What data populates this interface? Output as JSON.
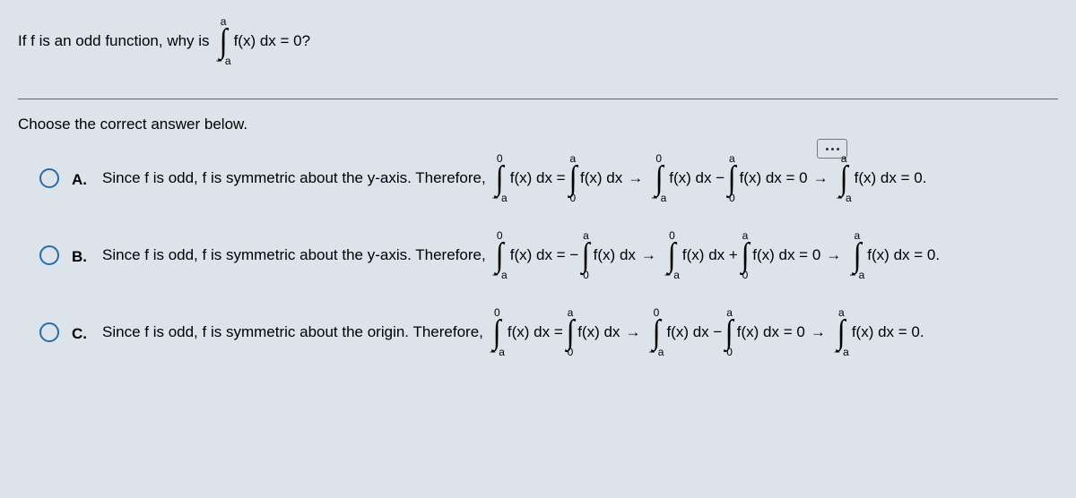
{
  "question": {
    "lead": "If f is an odd function, why is",
    "int_upper": "a",
    "int_lower": "− a",
    "integrand": "f(x) dx = 0?"
  },
  "prompt": "Choose the correct answer below.",
  "int_sym": "∫",
  "arrow": "→",
  "options": [
    {
      "label": "A.",
      "text": "Since f is odd, f is symmetric about the y-axis. Therefore,",
      "eq": {
        "i1_u": "0",
        "i1_l": "− a",
        "i1_body": "f(x) dx =",
        "i2_u": "a",
        "i2_l": "0",
        "i2_body": "f(x) dx",
        "i3_u": "0",
        "i3_l": "− a",
        "i3_body": "f(x) dx −",
        "i4_u": "a",
        "i4_l": "0",
        "i4_body": "f(x) dx = 0",
        "i5_u": "a",
        "i5_l": "− a",
        "i5_body": "f(x) dx = 0."
      }
    },
    {
      "label": "B.",
      "text": "Since f is odd, f is symmetric about the y-axis. Therefore,",
      "eq": {
        "i1_u": "0",
        "i1_l": "− a",
        "i1_body": "f(x) dx = −",
        "i2_u": "a",
        "i2_l": "0",
        "i2_body": "f(x) dx",
        "i3_u": "0",
        "i3_l": "− a",
        "i3_body": "f(x) dx +",
        "i4_u": "a",
        "i4_l": "0",
        "i4_body": "f(x) dx = 0",
        "i5_u": "a",
        "i5_l": "− a",
        "i5_body": "f(x) dx = 0."
      }
    },
    {
      "label": "C.",
      "text": "Since f is odd, f is symmetric about the origin. Therefore,",
      "eq": {
        "i1_u": "0",
        "i1_l": "− a",
        "i1_body": "f(x) dx =",
        "i2_u": "a",
        "i2_l": "0",
        "i2_body": "f(x) dx",
        "i3_u": "0",
        "i3_l": "− a",
        "i3_body": "f(x) dx −",
        "i4_u": "a",
        "i4_l": "0",
        "i4_body": "f(x) dx = 0",
        "i5_u": "a",
        "i5_l": "− a",
        "i5_body": "f(x) dx = 0."
      }
    }
  ]
}
